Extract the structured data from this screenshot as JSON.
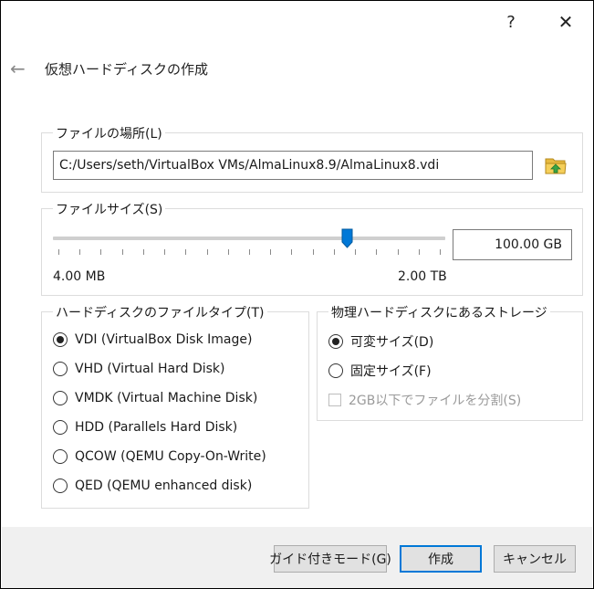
{
  "window": {
    "help_symbol": "?",
    "close_symbol": "✕",
    "back_icon": "←"
  },
  "dialog": {
    "title": "仮想ハードディスクの作成"
  },
  "file_location": {
    "legend": "ファイルの場所(L)",
    "path": "C:/Users/seth/VirtualBox VMs/AlmaLinux8.9/AlmaLinux8.vdi",
    "folder_icon": "folder-icon"
  },
  "file_size": {
    "legend": "ファイルサイズ(S)",
    "value": "100.00 GB",
    "min_label": "4.00 MB",
    "max_label": "2.00 TB",
    "slider_position": 0.75
  },
  "disk_type": {
    "legend": "ハードディスクのファイルタイプ(T)",
    "options": [
      {
        "label": "VDI (VirtualBox Disk Image)",
        "checked": true
      },
      {
        "label": "VHD (Virtual Hard Disk)",
        "checked": false
      },
      {
        "label": "VMDK (Virtual Machine Disk)",
        "checked": false
      },
      {
        "label": "HDD (Parallels Hard Disk)",
        "checked": false
      },
      {
        "label": "QCOW (QEMU Copy-On-Write)",
        "checked": false
      },
      {
        "label": "QED (QEMU enhanced disk)",
        "checked": false
      }
    ]
  },
  "storage": {
    "legend": "物理ハードディスクにあるストレージ",
    "options": [
      {
        "label": "可変サイズ(D)",
        "checked": true
      },
      {
        "label": "固定サイズ(F)",
        "checked": false
      }
    ],
    "split_checkbox": {
      "label": "2GB以下でファイルを分割(S)",
      "checked": false,
      "disabled": true
    }
  },
  "buttons": {
    "guided": "ガイド付きモード(G)",
    "create": "作成",
    "cancel": "キャンセル"
  },
  "colors": {
    "accent": "#0078d7",
    "footer_bg": "#f0f0f0"
  }
}
